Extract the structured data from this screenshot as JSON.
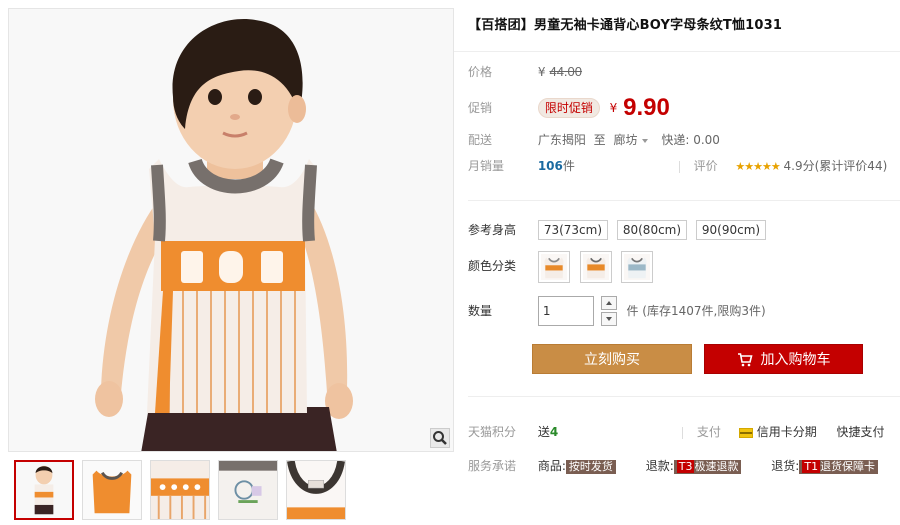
{
  "product": {
    "title": "【百搭团】男童无袖卡通背心BOY字母条纹T恤1031"
  },
  "price": {
    "label": "价格",
    "original_currency": "¥",
    "original": "44.00",
    "promo_label": "促销",
    "promo_tag": "限时促销",
    "promo_currency": "¥",
    "promo": "9.90"
  },
  "shipping": {
    "label": "配送",
    "from": "广东揭阳",
    "to_word": "至",
    "destination": "廊坊",
    "express": "快递: 0.00"
  },
  "sales": {
    "label": "月销量",
    "count": "106",
    "unit": "件",
    "review_label": "评价",
    "stars": "★★★★★",
    "score_text": "4.9分",
    "review_count_text": "(累计评价44)"
  },
  "sizes": {
    "label": "参考身高",
    "options": [
      "73(73cm)",
      "80(80cm)",
      "90(90cm)"
    ]
  },
  "colors": {
    "label": "颜色分类",
    "options": [
      {
        "name": "color-option-1",
        "accent": "#e88a2a",
        "trim": "#8b8b8b"
      },
      {
        "name": "color-option-2",
        "accent": "#e88a2a",
        "trim": "#6b6b6b"
      },
      {
        "name": "color-option-3",
        "accent": "#9cb8c7",
        "trim": "#777777"
      }
    ]
  },
  "quantity": {
    "label": "数量",
    "value": "1",
    "note": "件 (库存1407件,限购3件)"
  },
  "actions": {
    "buy_now": "立刻购买",
    "add_cart": "加入购物车"
  },
  "points": {
    "label": "天猫积分",
    "prefix": "送",
    "value": "4"
  },
  "payment": {
    "label": "支付",
    "credit": "信用卡分期",
    "quick": "快捷支付"
  },
  "service": {
    "label": "服务承诺",
    "goods_label": "商品:",
    "goods_badge": "按时发货",
    "refund_label": "退款:",
    "refund_code": "T3",
    "refund_badge": "极速退款",
    "return_label": "退货:",
    "return_code": "T1",
    "return_badge": "退货保障卡"
  },
  "colors_theme": {
    "price_red": "#c40000",
    "buy_brown": "#c98d45",
    "cart_red": "#c40000",
    "star_gold": "#e8a200"
  },
  "thumbnails": [
    "thumb-model-front",
    "thumb-vest-back",
    "thumb-fabric-detail",
    "thumb-print-detail",
    "thumb-collar-label"
  ]
}
